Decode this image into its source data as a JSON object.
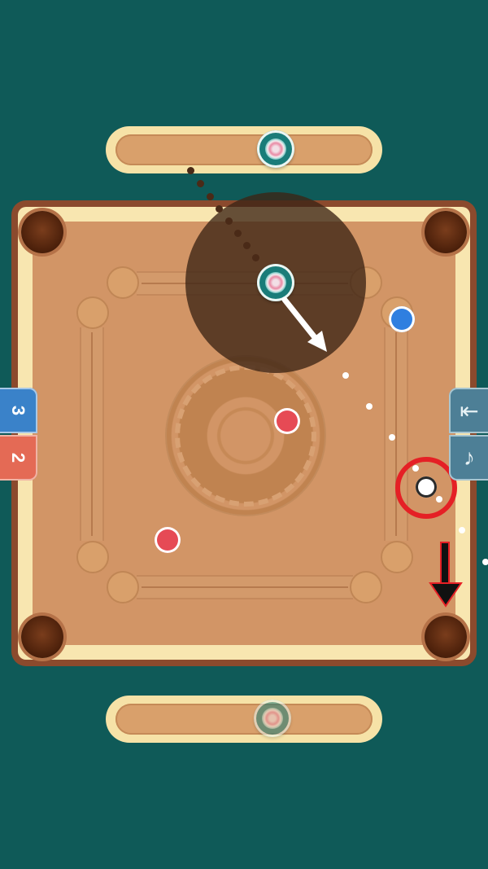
{
  "game": {
    "score_blue": "3",
    "score_red": "2"
  },
  "icons": {
    "exit": "exit-door-icon",
    "music": "music-note-icon",
    "arrow_down": "arrow-down-icon",
    "aim_arrow": "aim-direction-arrow-icon"
  },
  "glyphs": {
    "exit": "⇤",
    "music": "♪"
  },
  "colors": {
    "background": "#0f5a58",
    "board": "#d29566",
    "red_coin": "#e64a55",
    "blue_coin": "#2f7fe0",
    "highlight": "#e52025"
  }
}
